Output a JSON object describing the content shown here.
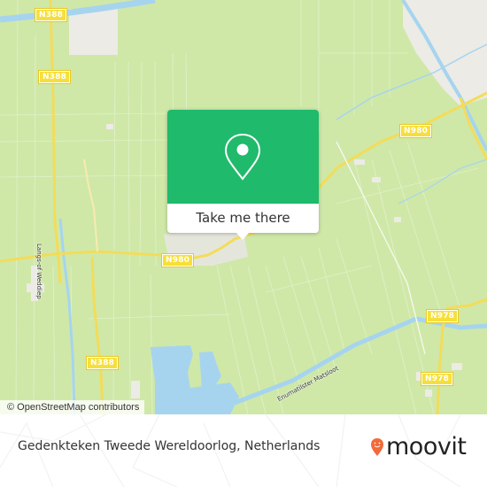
{
  "map": {
    "colors": {
      "land": "#cfe8a8",
      "water": "#a6d4ef",
      "urban": "#ecebe6",
      "major_road": "#f3dc5a",
      "accent": "#1fba6b"
    },
    "road_shields": [
      {
        "id": "n388-top",
        "label": "N388"
      },
      {
        "id": "n388-mid",
        "label": "N388"
      },
      {
        "id": "n388-bottom",
        "label": "N388"
      },
      {
        "id": "n980-center",
        "label": "N980"
      },
      {
        "id": "n980-right",
        "label": "N980"
      },
      {
        "id": "n978-upper",
        "label": "N978"
      },
      {
        "id": "n978-lower",
        "label": "N978"
      }
    ],
    "road_labels": [
      {
        "id": "langs-of-weddiep",
        "label": "Langs-of Weddiep"
      },
      {
        "id": "enumatilster-matsloot",
        "label": "Enumatilster Matsloot"
      }
    ],
    "attribution": "© OpenStreetMap contributors"
  },
  "popup": {
    "icon": "location-pin-icon",
    "button_label": "Take me there"
  },
  "footer": {
    "place_name": "Gedenkteken Tweede Wereldoorlog, Netherlands",
    "brand": "moovit",
    "brand_color": "#f26a3a"
  }
}
